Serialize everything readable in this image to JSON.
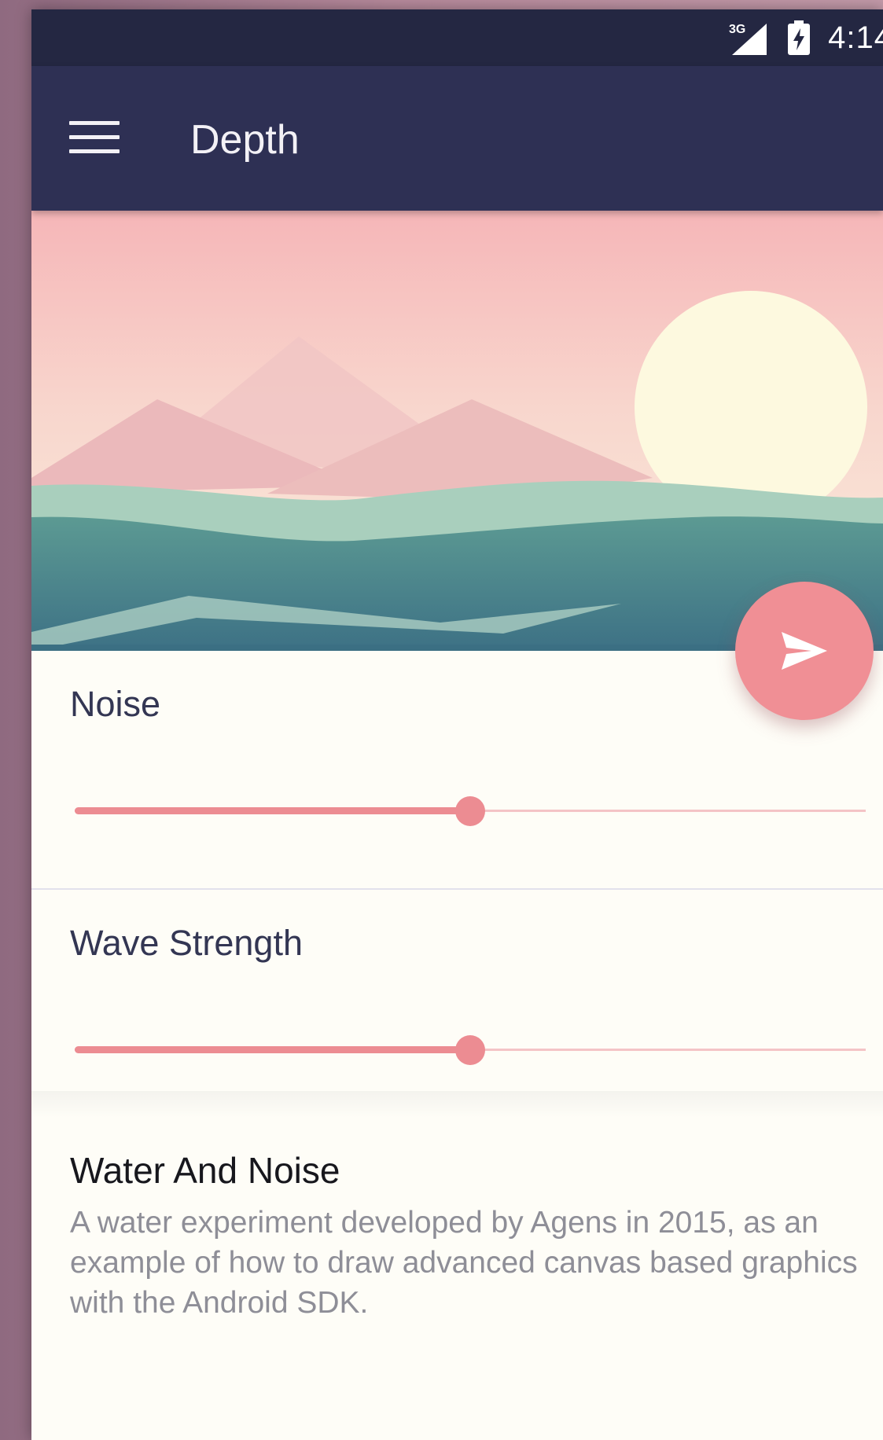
{
  "status_bar": {
    "network": "3G",
    "time": "4:14"
  },
  "app_bar": {
    "title": "Depth",
    "menu_icon": "hamburger-menu-icon"
  },
  "fab": {
    "icon": "send-icon",
    "color": "#f08f95"
  },
  "controls": [
    {
      "label": "Noise",
      "value": 0.5
    },
    {
      "label": "Wave Strength",
      "value": 0.5
    }
  ],
  "info": {
    "title": "Water And Noise",
    "description": "A water experiment developed by Agens in 2015, as an example of how to draw advanced canvas based graphics with the Android SDK."
  },
  "colors": {
    "app_bar": "#2e3054",
    "status_bar": "#242742",
    "accent": "#ec8c92",
    "background": "#fefdf7"
  }
}
